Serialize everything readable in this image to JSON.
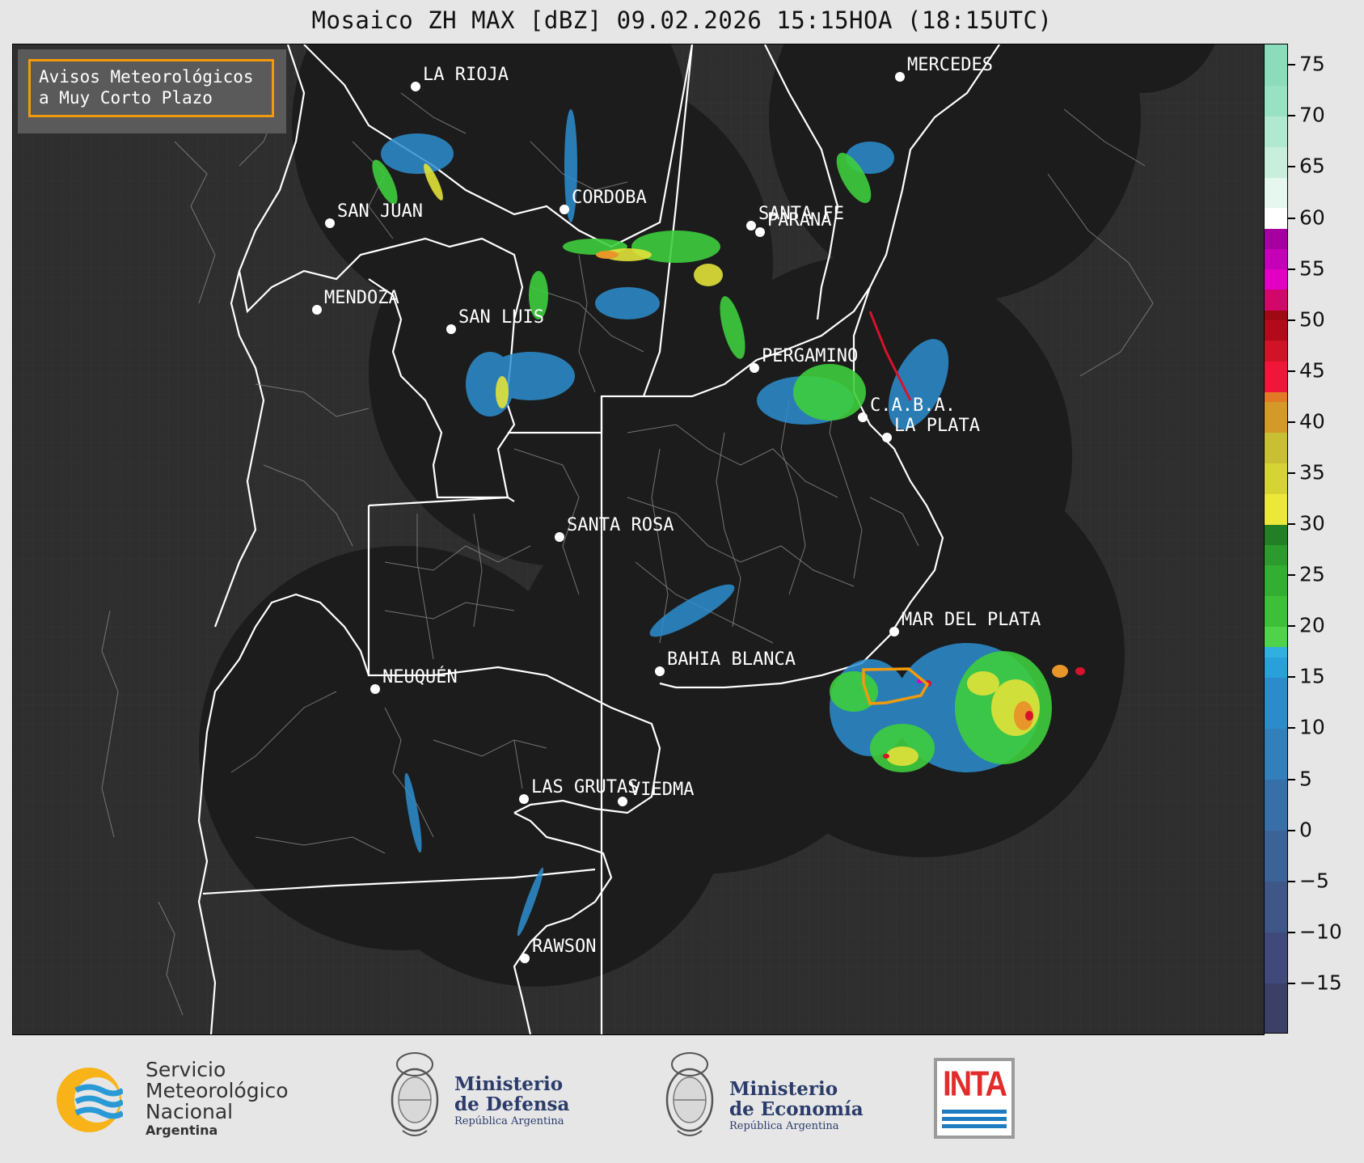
{
  "title": "Mosaico ZH MAX [dBZ] 09.02.2026 15:15HOA (18:15UTC)",
  "alert_box": {
    "line1": "Avisos Meteorológicos",
    "line2": "a Muy Corto Plazo",
    "border_color": "#f19a0c"
  },
  "cities": [
    {
      "name": "LA RIOJA"
    },
    {
      "name": "MERCEDES"
    },
    {
      "name": "SAN JUAN"
    },
    {
      "name": "CORDOBA"
    },
    {
      "name": "SANTA FE"
    },
    {
      "name": "PARANA"
    },
    {
      "name": "MENDOZA"
    },
    {
      "name": "SAN LUIS"
    },
    {
      "name": "PERGAMINO"
    },
    {
      "name": "C.A.B.A."
    },
    {
      "name": "LA PLATA"
    },
    {
      "name": "SANTA ROSA"
    },
    {
      "name": "MAR DEL PLATA"
    },
    {
      "name": "BAHIA BLANCA"
    },
    {
      "name": "NEUQUÉN"
    },
    {
      "name": "LAS GRUTAS"
    },
    {
      "name": "VIEDMA"
    },
    {
      "name": "RAWSON"
    }
  ],
  "colorbar": {
    "unit": "dBZ",
    "ticks": [
      "75",
      "70",
      "65",
      "60",
      "55",
      "50",
      "45",
      "40",
      "35",
      "30",
      "25",
      "20",
      "15",
      "10",
      "5",
      "0",
      "−5",
      "−10",
      "−15"
    ],
    "range": [
      -20,
      77
    ],
    "colors": {
      "low": "#3b3f6e",
      "blue": "#2b8ccf",
      "green": "#3ecf3e",
      "yellow": "#e2e23a",
      "orange": "#e8952a",
      "red": "#d6132d",
      "magenta": "#d400c8",
      "white": "#ffffff",
      "teal": "#8fe0c0"
    }
  },
  "footer": {
    "smn": {
      "line1": "Servicio",
      "line2": "Meteorológico",
      "line3": "Nacional",
      "line4": "Argentina"
    },
    "defensa": {
      "line1": "Ministerio",
      "line2": "de Defensa",
      "line3": "República Argentina"
    },
    "economia": {
      "line1": "Ministerio",
      "line2": "de Economía",
      "line3": "República Argentina"
    },
    "inta": {
      "label": "INTA"
    }
  }
}
